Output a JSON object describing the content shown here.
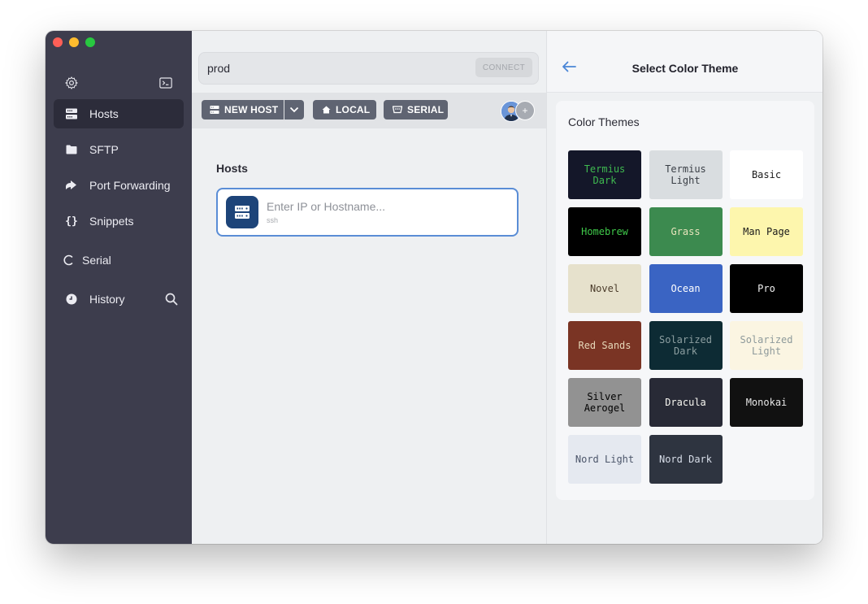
{
  "sidebar": {
    "items": [
      {
        "label": "Hosts",
        "active": true
      },
      {
        "label": "SFTP"
      },
      {
        "label": "Port Forwarding"
      },
      {
        "label": "Snippets"
      },
      {
        "label": "Serial"
      },
      {
        "label": "History"
      }
    ],
    "icons": [
      "gear-icon",
      "terminal-icon",
      "server-icon",
      "folder-icon",
      "forward-arrow-icon",
      "braces-icon",
      "serial-icon",
      "clock-icon",
      "search-icon"
    ]
  },
  "search": {
    "value": "prod",
    "connect_label": "CONNECT"
  },
  "toolbar": {
    "new_host_label": "NEW HOST",
    "local_label": "LOCAL",
    "serial_label": "SERIAL"
  },
  "hosts": {
    "title": "Hosts",
    "input_placeholder": "Enter IP or Hostname...",
    "input_subtitle": "ssh"
  },
  "panel": {
    "title": "Select Color Theme",
    "section_label": "Color Themes",
    "themes": [
      {
        "name": "Termius Dark",
        "bg": "#141729",
        "fg": "#3fb950"
      },
      {
        "name": "Termius Light",
        "bg": "#d9dde0",
        "fg": "#3a3f46"
      },
      {
        "name": "Basic",
        "bg": "#ffffff",
        "fg": "#1a1a1a"
      },
      {
        "name": "Homebrew",
        "bg": "#000000",
        "fg": "#3fc94a"
      },
      {
        "name": "Grass",
        "bg": "#3c8a4f",
        "fg": "#e9e5bd"
      },
      {
        "name": "Man Page",
        "bg": "#fdf6ad",
        "fg": "#1a1a1a"
      },
      {
        "name": "Novel",
        "bg": "#e6e1cc",
        "fg": "#4a3b2a"
      },
      {
        "name": "Ocean",
        "bg": "#3a64c3",
        "fg": "#ffffff"
      },
      {
        "name": "Pro",
        "bg": "#000000",
        "fg": "#f0f0f0"
      },
      {
        "name": "Red Sands",
        "bg": "#7a3424",
        "fg": "#e6d7b8"
      },
      {
        "name": "Solarized Dark",
        "bg": "#0d2b34",
        "fg": "#8c9ea0"
      },
      {
        "name": "Solarized Light",
        "bg": "#fbf5e2",
        "fg": "#8e9a9b"
      },
      {
        "name": "Silver Aerogel",
        "bg": "#929292",
        "fg": "#000000"
      },
      {
        "name": "Dracula",
        "bg": "#282a36",
        "fg": "#f8f8f2"
      },
      {
        "name": "Monokai",
        "bg": "#111111",
        "fg": "#e6e6e6"
      },
      {
        "name": "Nord Light",
        "bg": "#e5e9f0",
        "fg": "#4c566a"
      },
      {
        "name": "Nord Dark",
        "bg": "#2e3440",
        "fg": "#d8dee9"
      }
    ]
  },
  "colors": {
    "sidebar_bg": "#3d3d4d",
    "accent": "#5a8dd6",
    "button_bg": "#5f6472"
  }
}
